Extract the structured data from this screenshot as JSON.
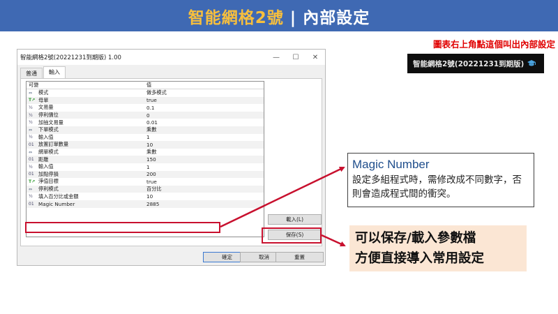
{
  "banner": {
    "part1": "智能網格2號",
    "sep": " | ",
    "part2": "內部設定"
  },
  "hint_red": "圖表右上角點這個叫出內部設定",
  "chart_strip": {
    "text": "智能網格2號(20221231到期版)",
    "icon": "graduation-cap-icon"
  },
  "dialog": {
    "title": "智能網格2號(20221231到期版) 1.00",
    "minimize": "—",
    "maximize": "☐",
    "close": "✕",
    "tabs": [
      {
        "label": "普通",
        "active": false
      },
      {
        "label": "輸入",
        "active": true
      }
    ],
    "table": {
      "col_name": "可變",
      "col_value": "值",
      "rows": [
        {
          "type": "enum",
          "name": "模式",
          "value": "做多模式"
        },
        {
          "type": "bool",
          "name": "母單",
          "value": "true"
        },
        {
          "type": "num",
          "name": "文易量",
          "value": "0.1"
        },
        {
          "type": "num",
          "name": "停利價位",
          "value": "0"
        },
        {
          "type": "num",
          "name": "加抽文易量",
          "value": "0.01"
        },
        {
          "type": "enum",
          "name": "下單模式",
          "value": "乘數"
        },
        {
          "type": "num",
          "name": "輸入值",
          "value": "1"
        },
        {
          "type": "int",
          "name": "放置訂單數量",
          "value": "10"
        },
        {
          "type": "enum",
          "name": "網單模式",
          "value": "乘數"
        },
        {
          "type": "int",
          "name": "距離",
          "value": "150"
        },
        {
          "type": "num",
          "name": "輸入值",
          "value": "1"
        },
        {
          "type": "int",
          "name": "加點停損",
          "value": "200"
        },
        {
          "type": "bool",
          "name": "淨值目標",
          "value": "true"
        },
        {
          "type": "enum",
          "name": "停利模式",
          "value": "百分比"
        },
        {
          "type": "num",
          "name": "填入百分比或金額",
          "value": "10"
        },
        {
          "type": "int",
          "name": "Magic Number",
          "value": "2885"
        }
      ]
    },
    "buttons": {
      "load": "載入(L)",
      "save": "保存(S)",
      "ok": "確定",
      "cancel": "取消",
      "reset": "重置"
    },
    "type_glyphs": {
      "enum": "⇔",
      "bool": "T↗",
      "num": "½",
      "int": "01"
    }
  },
  "callout_magic": {
    "title": "Magic Number",
    "body": "設定多組程式時，需修改成不同數字，否則會造成程式間的衝突。"
  },
  "callout_save": {
    "line1": "可以保存/載入參數檔",
    "line2": "方便直接導入常用設定"
  },
  "colors": {
    "banner_bg": "#3f69b3",
    "banner_accent": "#f7bf3d",
    "highlight_red": "#c8102e",
    "callout_fill": "#fbe6d4"
  }
}
